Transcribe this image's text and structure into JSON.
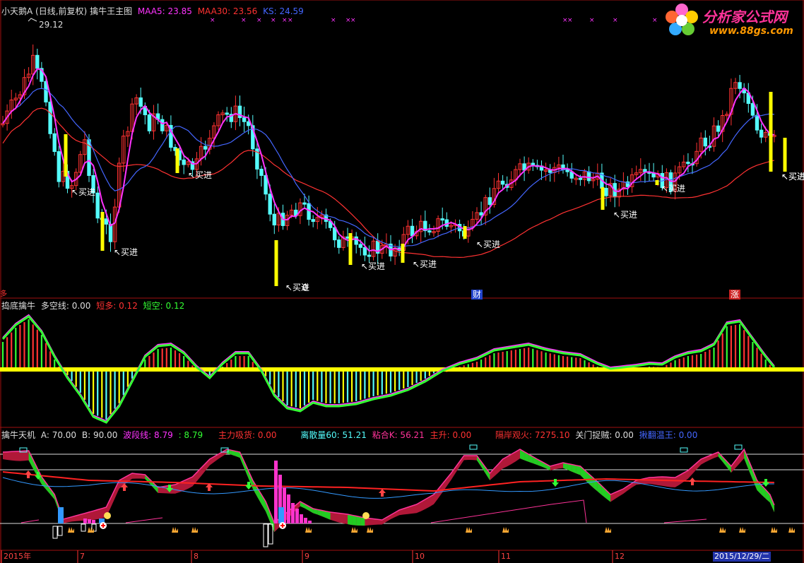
{
  "header": {
    "stock": "小天鹅A",
    "period": "(日线,前复权)",
    "indicator": "擒牛王主图",
    "maa5": "MAA5: 23.85",
    "maa30": "MAA30: 23.56",
    "ks": "KS: 24.59"
  },
  "logo": {
    "title": "分析家公式网",
    "url": "www.88gs.com"
  },
  "panel2": {
    "name": "捣底擒牛",
    "duo": "多空线: 0.00",
    "duanduo": "短多: 0.12",
    "duankong": "短空: 0.12"
  },
  "panel3": {
    "name": "擒牛天机",
    "a": "A: 70.00",
    "b": "B: 90.00",
    "boduan": "波段线: 8.79",
    "v2": ": 8.79",
    "zhuli": "主力吸货: 0.00",
    "lisan": "离散量60: 51.21",
    "zhanhe": "粘合K: 56.21",
    "zhusheng": "主升: 0.00",
    "gean": "隔岸观火: 7275.10",
    "guanmen": "关门捉贼: 0.00",
    "leng": "揪翻温王: 0.00"
  },
  "markers": {
    "buy": "买进",
    "high_value": "29.12",
    "low_suffix": "0",
    "cai": "财",
    "zhang": "涨",
    "side": "多"
  },
  "xaxis": [
    "2015年",
    "7",
    "8",
    "9",
    "10",
    "11",
    "12"
  ],
  "xaxis_date": "2015/12/29/二",
  "colors": {
    "up": "#ff3232",
    "down": "#54fcfc",
    "buy_bar": "#ffff00",
    "maa5": "#ff33ff",
    "maa30": "#ff3232",
    "ks": "#4466ff",
    "green": "#33ff33",
    "grid": "#a01010"
  },
  "chart_data": [
    {
      "type": "candlestick",
      "title": "擒牛王主图",
      "series": [
        {
          "name": "MAA5",
          "last": 23.85
        },
        {
          "name": "MAA30",
          "last": 23.56
        },
        {
          "name": "KS",
          "last": 24.59
        }
      ],
      "annotations": [
        {
          "text": "29.12",
          "kind": "high"
        }
      ],
      "buy_signals": 13,
      "x_ticks": [
        "2015年",
        "7",
        "8",
        "9",
        "10",
        "11",
        "12",
        "2015/12/29/二"
      ]
    },
    {
      "type": "bar",
      "title": "捣底擒牛",
      "series": [
        {
          "name": "多空线",
          "last": 0.0
        },
        {
          "name": "短多",
          "last": 0.12
        },
        {
          "name": "短空",
          "last": 0.12
        }
      ]
    },
    {
      "type": "area",
      "title": "擒牛天机",
      "series": [
        {
          "name": "A",
          "last": 70.0
        },
        {
          "name": "B",
          "last": 90.0
        },
        {
          "name": "波段线",
          "last": 8.79
        },
        {
          "name": "主力吸货",
          "last": 0.0
        },
        {
          "name": "离散量60",
          "last": 51.21
        },
        {
          "name": "粘合K",
          "last": 56.21
        },
        {
          "name": "主升",
          "last": 0.0
        },
        {
          "name": "隔岸观火",
          "last": 7275.1
        },
        {
          "name": "关门捉贼",
          "last": 0.0
        }
      ]
    }
  ]
}
